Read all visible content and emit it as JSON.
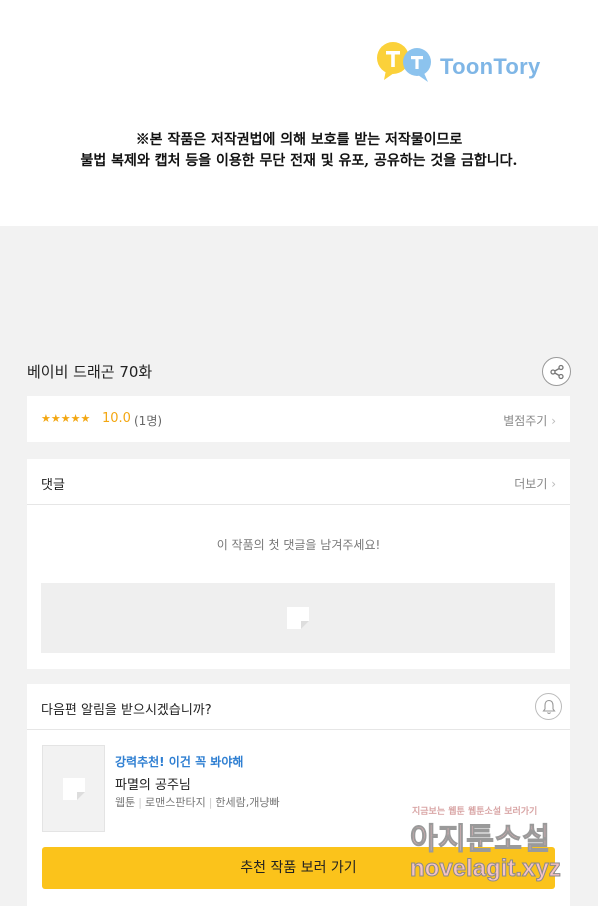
{
  "header": {
    "logo_text": "ToonTory",
    "copyright_line1": "※본 작품은 저작권법에 의해 보호를 받는 저작물이므로",
    "copyright_line2": "불법 복제와 캡처 등을 이용한 무단 전재 및 유포, 공유하는 것을 금합니다."
  },
  "episode": {
    "title": "베이비 드래곤 70화",
    "share_icon": "share-icon"
  },
  "rating": {
    "stars": "★★★★★",
    "score": "10.0",
    "count": "(1명)",
    "rate_link": "별점주기",
    "accent_color": "#f3a712"
  },
  "comments": {
    "title": "댓글",
    "more_link": "더보기",
    "empty_message": "이 작품의 첫 댓글을 남겨주세요!"
  },
  "notify": {
    "question": "다음편 알림을 받으시겠습니까?",
    "bell_icon": "bell-icon",
    "recommend_label": "강력추천! 이건 꼭 봐야해",
    "recommend_title": "파멸의 공주님",
    "meta_type": "웹툰",
    "meta_genre": "로맨스판타지",
    "meta_authors": "한세람,개냥빠",
    "cta_label": "추천 작품 보러 가기",
    "cta_color": "#fbc31b"
  },
  "watermark": {
    "tagline": "지금보는 웹툰 웹툰소설 보러가기",
    "name": "아지툰소설",
    "url": "novelagit.xyz"
  }
}
